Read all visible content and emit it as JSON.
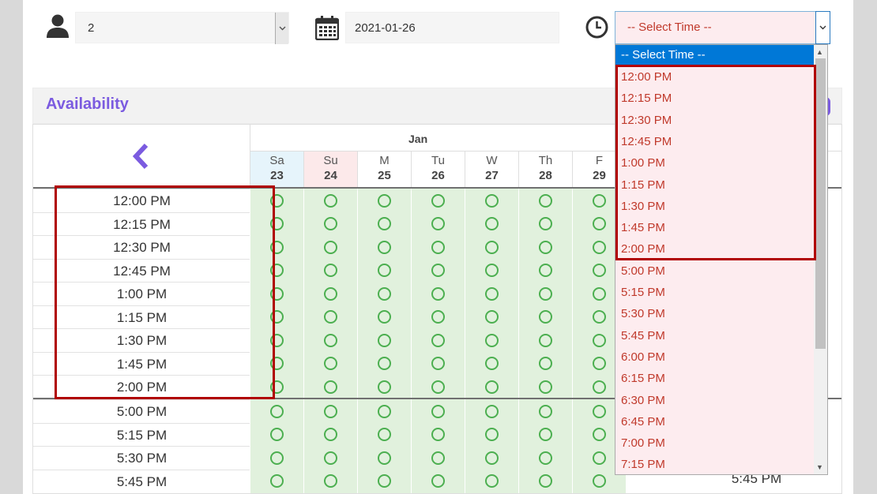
{
  "form": {
    "party_size": "2",
    "date": "2021-01-26",
    "time_placeholder": "-- Select Time --"
  },
  "availability": {
    "title": "Availability",
    "month": "Jan",
    "days": [
      {
        "name": "Sa",
        "date": "23"
      },
      {
        "name": "Su",
        "date": "24"
      },
      {
        "name": "M",
        "date": "25"
      },
      {
        "name": "Tu",
        "date": "26"
      },
      {
        "name": "W",
        "date": "27"
      },
      {
        "name": "Th",
        "date": "28"
      },
      {
        "name": "F",
        "date": "29"
      }
    ],
    "times": [
      "12:00 PM",
      "12:15 PM",
      "12:30 PM",
      "12:45 PM",
      "1:00 PM",
      "1:15 PM",
      "1:30 PM",
      "1:45 PM",
      "2:00 PM",
      "5:00 PM",
      "5:15 PM",
      "5:30 PM",
      "5:45 PM"
    ],
    "right_visible_time": "5:45 PM"
  },
  "dropdown": {
    "selected": "-- Select Time --",
    "options": [
      "12:00 PM",
      "12:15 PM",
      "12:30 PM",
      "12:45 PM",
      "1:00 PM",
      "1:15 PM",
      "1:30 PM",
      "1:45 PM",
      "2:00 PM",
      "5:00 PM",
      "5:15 PM",
      "5:30 PM",
      "5:45 PM",
      "6:00 PM",
      "6:15 PM",
      "6:30 PM",
      "6:45 PM",
      "7:00 PM",
      "7:15 PM"
    ]
  },
  "colors": {
    "accent": "#7b5be0",
    "available": "#4caf50",
    "available_bg": "#e1f1dd",
    "saturday_bg": "#e6f4fb",
    "sunday_bg": "#fce9ea",
    "highlight": "#b00000"
  },
  "icons": {
    "party": "person-icon",
    "date": "calendar-icon",
    "time": "clock-icon",
    "prev": "chevron-left-icon"
  }
}
